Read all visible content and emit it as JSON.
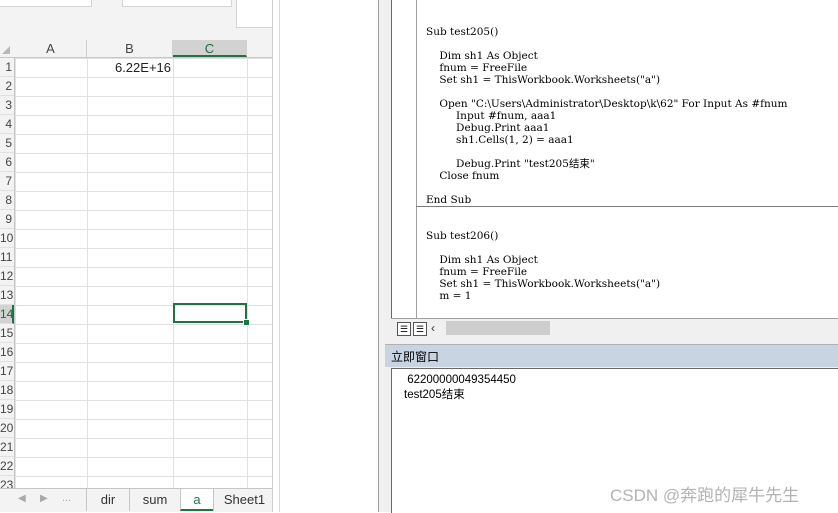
{
  "excel": {
    "columns": [
      "A",
      "B",
      "C"
    ],
    "rows": [
      "1",
      "2",
      "3",
      "4",
      "5",
      "6",
      "7",
      "8",
      "9",
      "10",
      "11",
      "12",
      "13",
      "14",
      "15",
      "16",
      "17",
      "18",
      "19",
      "20",
      "21",
      "22",
      "23"
    ],
    "cells": {
      "B1": "6.22E+16"
    },
    "active_cell": "C14",
    "sheets": [
      "dir",
      "sum",
      "a",
      "Sheet1"
    ],
    "active_sheet": "a",
    "nav_ellipsis": "..."
  },
  "vbe": {
    "code_lines": [
      "Sub test205()",
      "",
      "    Dim sh1 As Object",
      "    fnum = FreeFile",
      "    Set sh1 = ThisWorkbook.Worksheets(\"a\")",
      "",
      "    Open \"C:\\Users\\Administrator\\Desktop\\k\\62\" For Input As #fnum",
      "         Input #fnum, aaa1",
      "         Debug.Print aaa1",
      "         sh1.Cells(1, 2) = aaa1",
      "",
      "         Debug.Print \"test205结束\"",
      "    Close fnum",
      "",
      "End Sub",
      "",
      "",
      "Sub test206()",
      "",
      "    Dim sh1 As Object",
      "    fnum = FreeFile",
      "    Set sh1 = ThisWorkbook.Worksheets(\"a\")",
      "    m = 1"
    ],
    "immediate_title": "立即窗口",
    "immediate_lines": [
      " 62200000049354450",
      "test205结束"
    ]
  },
  "watermark": "CSDN @奔跑的犀牛先生",
  "colors": {
    "excel_green": "#217346",
    "imm_title_bg": "#c9d4e2"
  }
}
